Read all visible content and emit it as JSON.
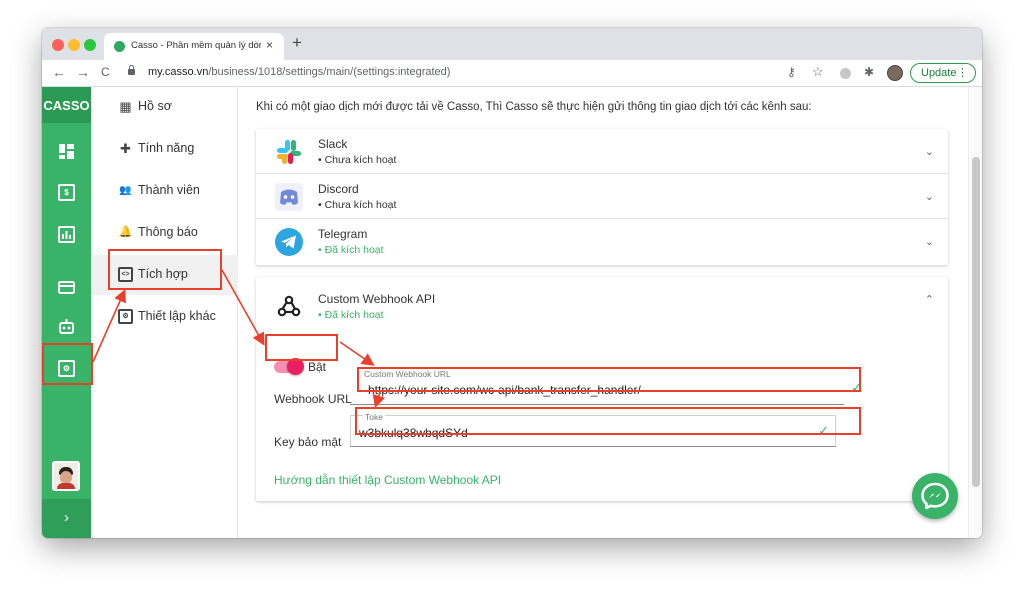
{
  "browser": {
    "tab_title": "Casso - Phần mềm quản lý dòng",
    "tab_close": "×",
    "new_tab": "+",
    "url_host": "my.casso.vn",
    "url_path": "/business/1018/settings/main/(settings:integrated)",
    "update_label": "Update",
    "update_menu": "⋮",
    "back_icon": "←",
    "forward_icon": "→",
    "reload_icon": "C",
    "key_icon": "⚷",
    "star_icon": "☆",
    "extension_icon": "✱"
  },
  "leftbar": {
    "brand": "CASSO",
    "expand": "›",
    "icons": [
      "dashboard-icon",
      "cash-icon",
      "report-icon",
      "card-icon",
      "bot-icon",
      "settings-icon"
    ]
  },
  "submenu": {
    "items": [
      {
        "label": "Hồ sơ",
        "glyph": "▦"
      },
      {
        "label": "Tính năng",
        "glyph": "✚"
      },
      {
        "label": "Thành viên",
        "glyph": "👥"
      },
      {
        "label": "Thông báo",
        "glyph": "🔔"
      },
      {
        "label": "Tích hợp",
        "glyph": "<>"
      },
      {
        "label": "Thiết lập khác",
        "glyph": "⚙"
      }
    ]
  },
  "main": {
    "intro": "Khi có một giao dịch mới được tải về Casso, Thì Casso sẽ thực hiện gửi thông tin giao dịch tới các kênh sau:",
    "channels": [
      {
        "name": "Slack",
        "status": "Chưa kích hoạt",
        "chevron": "⌄"
      },
      {
        "name": "Discord",
        "status": "Chưa kích hoạt",
        "chevron": "⌄"
      },
      {
        "name": "Telegram",
        "status": "Đã kích hoạt",
        "chevron": "⌄"
      }
    ],
    "webhook": {
      "name": "Custom Webhook API",
      "status": "Đã kích hoạt",
      "chevron": "⌃",
      "toggle_label": "Bật",
      "url_label": "Webhook URL",
      "url_float": "Custom Webhook URL",
      "url_value": "https://your-site.com/wc-api/bank_transfer_handler/",
      "key_label": "Key bảo mật",
      "key_float": "Toke",
      "key_value": "w3bkulq38wbqdSYd",
      "check": "✓",
      "guide_link": "Hướng dẫn thiết lập Custom Webhook API"
    }
  },
  "colors": {
    "brand_green": "#38b367",
    "toggle_pink": "#e91e63",
    "annotation_red": "#e8402a"
  }
}
